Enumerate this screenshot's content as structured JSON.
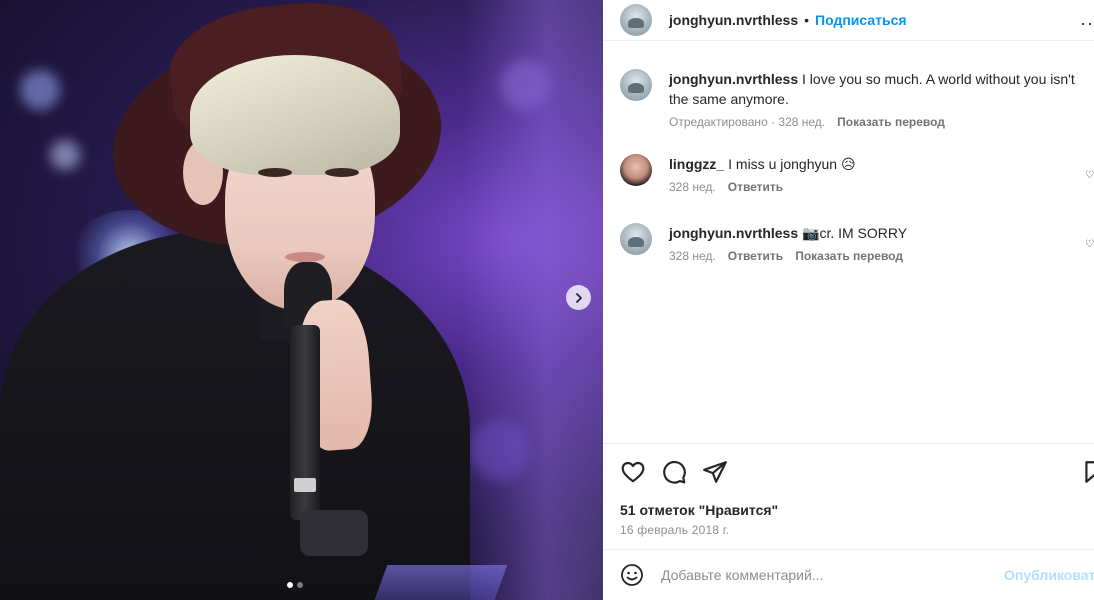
{
  "post": {
    "author": "jonghyun.nvrthless",
    "separator": "•",
    "follow_label": "Подписаться",
    "more_label": "··",
    "media": {
      "slide_count": 2,
      "active_slide": 1,
      "next_arrow_icon": "chevron-right-icon"
    }
  },
  "comments": [
    {
      "username": "jonghyun.nvrthless",
      "text": "I love you so much. A world without you isn't the same anymore.",
      "meta": [
        {
          "label": "Отредактировано · 328 нед.",
          "action": false
        },
        {
          "label": "Показать перевод",
          "action": true
        }
      ]
    },
    {
      "username": "linggzz_",
      "text": "I miss u jonghyun 😥",
      "meta": [
        {
          "label": "328 нед.",
          "action": false
        },
        {
          "label": "Ответить",
          "action": true
        }
      ]
    },
    {
      "username": "jonghyun.nvrthless",
      "text": "📷cr. IM SORRY",
      "meta": [
        {
          "label": "328 нед.",
          "action": false
        },
        {
          "label": "Ответить",
          "action": true
        },
        {
          "label": "Показать перевод",
          "action": true
        }
      ]
    }
  ],
  "actions": {
    "likes_text": "51 отметок \"Нравится\"",
    "date_text": "16 февраль 2018 г."
  },
  "comment_box": {
    "placeholder": "Добавьте комментарий...",
    "publish_label": "Опубликовать"
  },
  "colors": {
    "link_blue": "#0095f6",
    "publish_disabled": "#b2dffc",
    "text_primary": "#262626",
    "text_secondary": "#8e8e8e"
  }
}
